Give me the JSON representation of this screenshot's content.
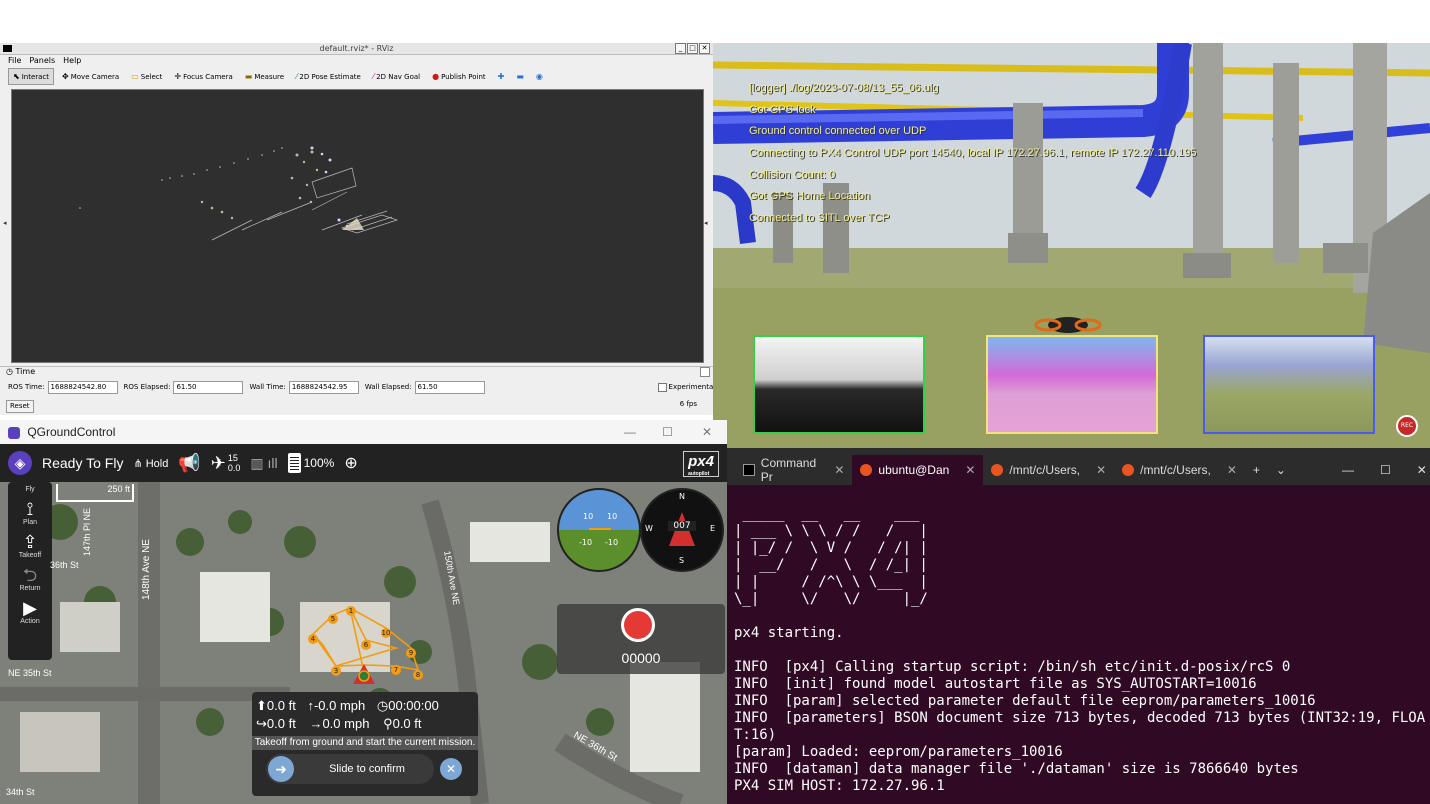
{
  "rviz": {
    "window_title": "default.rviz* - RViz",
    "menus": [
      "File",
      "Panels",
      "Help"
    ],
    "tools": [
      {
        "label": "Interact",
        "icon": "cursor-icon"
      },
      {
        "label": "Move Camera",
        "icon": "move-icon"
      },
      {
        "label": "Select",
        "icon": "select-icon"
      },
      {
        "label": "Focus Camera",
        "icon": "focus-icon"
      },
      {
        "label": "Measure",
        "icon": "ruler-icon"
      },
      {
        "label": "2D Pose Estimate",
        "icon": "green-arrow-icon"
      },
      {
        "label": "2D Nav Goal",
        "icon": "pink-arrow-icon"
      },
      {
        "label": "Publish Point",
        "icon": "red-pin-icon"
      }
    ],
    "time_panel": {
      "title": "Time",
      "ros_time_label": "ROS Time:",
      "ros_time": "1688824542.80",
      "ros_elapsed_label": "ROS Elapsed:",
      "ros_elapsed": "61.50",
      "wall_time_label": "Wall Time:",
      "wall_time": "1688824542.95",
      "wall_elapsed_label": "Wall Elapsed:",
      "wall_elapsed": "61.50",
      "experimental_label": "Experimental",
      "reset_label": "Reset",
      "fps": "6 fps"
    }
  },
  "sim": {
    "log_lines": [
      "[logger] ./log/2023-07-08/13_55_06.ulg",
      "Got GPS lock",
      "Ground control connected over UDP",
      "Connecting to PX4 Control UDP port 14540, local IP 172.27.96.1, remote IP 172.27.110.195",
      "Collision Count: 0",
      "Got GPS Home Location",
      "Connected to SITL over TCP"
    ],
    "record_label": "REC",
    "colors": {
      "log_text": "#f2ee8a",
      "pipe_blue": "#2f3fd6",
      "pipe_yellow": "#e0c41a"
    }
  },
  "qgc": {
    "window_title": "QGroundControl",
    "status": "Ready To Fly",
    "flight_mode": "Hold",
    "satellite_count": "15",
    "hdop": "0.0",
    "battery": "100%",
    "brand": "px4",
    "brand_sub": "autopilot",
    "scale": "250 ft",
    "fly_label": "Fly",
    "tools": [
      "Plan",
      "Takeoff",
      "Return",
      "Action"
    ],
    "compass_heading": "007",
    "attitude_ticks": [
      "10",
      "10",
      "-10",
      "-10"
    ],
    "compass_letters": [
      "N",
      "W",
      "E",
      "S"
    ],
    "video_counter": "00000",
    "streets": [
      "148th Ave NE",
      "147th Pl NE",
      "36th St",
      "NE 35th St",
      "150th Ave NE",
      "NE 36th St",
      "34th St"
    ],
    "telemetry": {
      "alt": "0.0 ft",
      "vspeed": "-0.0 mph",
      "time": "00:00:00",
      "dist": "0.0 ft",
      "hspeed": "0.0 mph",
      "home_dist": "0.0 ft"
    },
    "takeoff_hint": "Takeoff from ground and start the current mission.",
    "slide_label": "Slide to confirm",
    "waypoints": [
      "1",
      "2",
      "3",
      "4",
      "5",
      "6",
      "7",
      "8",
      "9",
      "10"
    ],
    "colors": {
      "toolbar": "#222222",
      "accent": "#2e7d32",
      "record": "#e53935",
      "mission": "#f39c12"
    }
  },
  "terminal": {
    "tabs": [
      {
        "label": "Command Pr",
        "icon": "cmd-icon",
        "active": false
      },
      {
        "label": "ubuntu@Dan",
        "icon": "ubuntu-icon",
        "active": true
      },
      {
        "label": "/mnt/c/Users,",
        "icon": "ubuntu-icon",
        "active": false
      },
      {
        "label": "/mnt/c/Users,",
        "icon": "ubuntu-icon",
        "active": false
      }
    ],
    "banner": [
      " _____  __   __    ___ ",
      "| ___ \\ \\ \\ / /   /   |",
      "| |_/ /  \\ V /   / /| |",
      "|  __/   /   \\  / /_| |",
      "| |     / /^\\ \\ \\___  |",
      "\\_|     \\/   \\/     |_/"
    ],
    "lines": [
      "px4 starting.",
      "",
      "INFO  [px4] Calling startup script: /bin/sh etc/init.d-posix/rcS 0",
      "INFO  [init] found model autostart file as SYS_AUTOSTART=10016",
      "INFO  [param] selected parameter default file eeprom/parameters_10016",
      "INFO  [parameters] BSON document size 713 bytes, decoded 713 bytes (INT32:19, FLOA",
      "T:16)",
      "[param] Loaded: eeprom/parameters_10016",
      "INFO  [dataman] data manager file './dataman' size is 7866640 bytes",
      "PX4 SIM HOST: 172.27.96.1"
    ]
  }
}
